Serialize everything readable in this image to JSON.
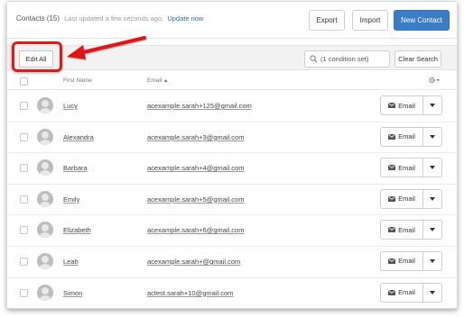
{
  "header": {
    "title": "Contacts (15)",
    "subtitle": "Last updated a few seconds ago.",
    "update_link": "Update now",
    "export_label": "Export",
    "import_label": "Import",
    "new_contact_label": "New Contact"
  },
  "toolbar": {
    "edit_all_label": "Edit All",
    "search_value": "(1 condition set)",
    "clear_search_label": "Clear Search"
  },
  "columns": {
    "first_name": "First Name",
    "email": "Email"
  },
  "contacts": [
    {
      "name": "Lucy",
      "email": "acexample.sarah+125@gmail.com",
      "action": "Email"
    },
    {
      "name": "Alexandra",
      "email": "acexample.sarah+3@gmail.com",
      "action": "Email"
    },
    {
      "name": "Barbara",
      "email": "acexample.sarah+4@gmail.com",
      "action": "Email"
    },
    {
      "name": "Emily",
      "email": "acexample.sarah+5@gmail.com",
      "action": "Email"
    },
    {
      "name": "Elizabeth",
      "email": "acexample.sarah+6@gmail.com",
      "action": "Email"
    },
    {
      "name": "Leah",
      "email": "acexample.sarah+@gmail.com",
      "action": "Email"
    },
    {
      "name": "Simon",
      "email": "actest.sarah+10@gmail.com",
      "action": "Email"
    }
  ],
  "colors": {
    "accent": "#3b7cc7",
    "highlight": "#e01919",
    "link": "#2f6aa8"
  },
  "icons": [
    "search-icon",
    "gear-icon",
    "sort-up-icon",
    "envelope-icon",
    "caret-down-icon",
    "avatar-icon",
    "arrow-annotation"
  ]
}
